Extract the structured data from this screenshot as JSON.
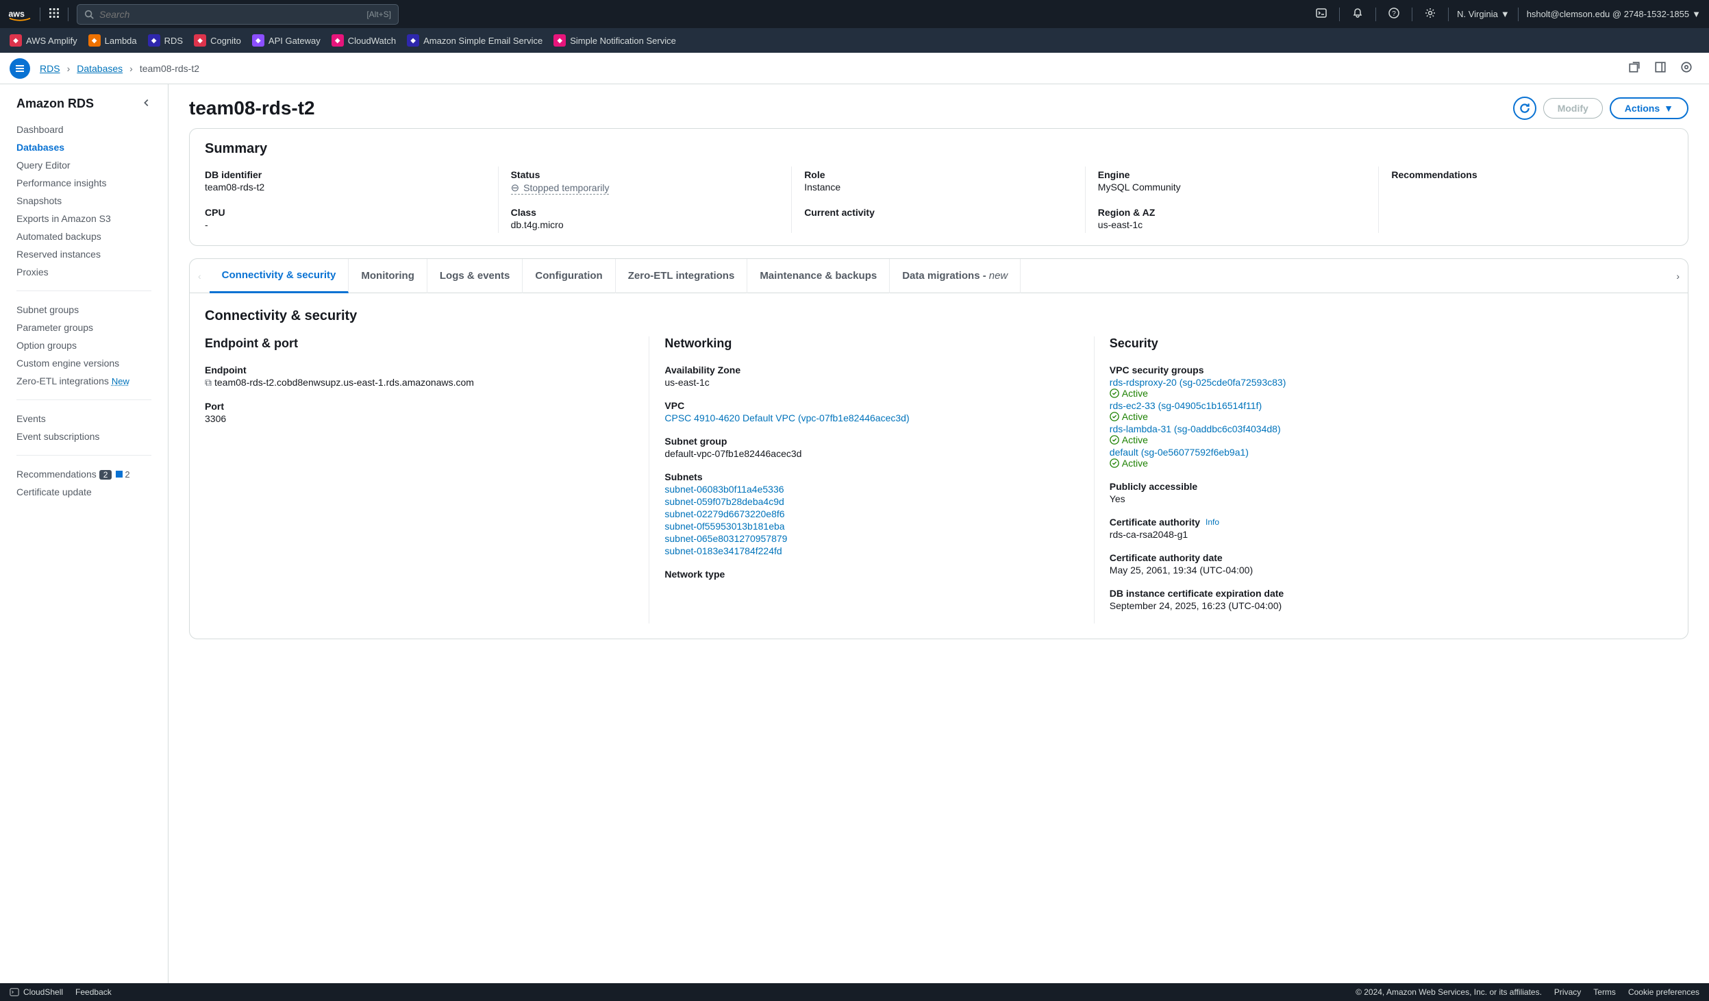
{
  "topnav": {
    "search_placeholder": "Search",
    "search_kbd": "[Alt+S]",
    "region": "N. Virginia",
    "account": "hsholt@clemson.edu @ 2748-1532-1855"
  },
  "favorites": [
    {
      "label": "AWS Amplify",
      "color": "#dd344c"
    },
    {
      "label": "Lambda",
      "color": "#ed7100"
    },
    {
      "label": "RDS",
      "color": "#2e27ad"
    },
    {
      "label": "Cognito",
      "color": "#dd344c"
    },
    {
      "label": "API Gateway",
      "color": "#8c4fff"
    },
    {
      "label": "CloudWatch",
      "color": "#e7157b"
    },
    {
      "label": "Amazon Simple Email Service",
      "color": "#2e27ad"
    },
    {
      "label": "Simple Notification Service",
      "color": "#e7157b"
    }
  ],
  "breadcrumb": {
    "root": "RDS",
    "parent": "Databases",
    "current": "team08-rds-t2"
  },
  "sidebar": {
    "title": "Amazon RDS",
    "groups": [
      [
        "Dashboard",
        "Databases",
        "Query Editor",
        "Performance insights",
        "Snapshots",
        "Exports in Amazon S3",
        "Automated backups",
        "Reserved instances",
        "Proxies"
      ],
      [
        "Subnet groups",
        "Parameter groups",
        "Option groups",
        "Custom engine versions",
        "Zero-ETL integrations"
      ],
      [
        "Events",
        "Event subscriptions"
      ],
      [
        "Recommendations",
        "Certificate update"
      ]
    ],
    "active": "Databases",
    "zero_etl_new": "New",
    "rec_badge1": "2",
    "rec_badge2": "2"
  },
  "page": {
    "title": "team08-rds-t2",
    "modify": "Modify",
    "actions": "Actions"
  },
  "summary": {
    "title": "Summary",
    "cells": [
      {
        "label": "DB identifier",
        "value": "team08-rds-t2"
      },
      {
        "label": "Status",
        "value": "Stopped temporarily",
        "status": true
      },
      {
        "label": "Role",
        "value": "Instance"
      },
      {
        "label": "Engine",
        "value": "MySQL Community"
      },
      {
        "label": "Recommendations",
        "value": ""
      },
      {
        "label": "CPU",
        "value": "-"
      },
      {
        "label": "Class",
        "value": "db.t4g.micro"
      },
      {
        "label": "Current activity",
        "value": ""
      },
      {
        "label": "Region & AZ",
        "value": "us-east-1c"
      },
      {
        "label": "",
        "value": ""
      }
    ]
  },
  "tabs": [
    "Connectivity & security",
    "Monitoring",
    "Logs & events",
    "Configuration",
    "Zero-ETL integrations",
    "Maintenance & backups",
    "Data migrations - "
  ],
  "tabs_new": "new",
  "conn": {
    "section_title": "Connectivity & security",
    "endpoint_port": "Endpoint & port",
    "endpoint_label": "Endpoint",
    "endpoint_value": "team08-rds-t2.cobd8enwsupz.us-east-1.rds.amazonaws.com",
    "port_label": "Port",
    "port_value": "3306",
    "networking": "Networking",
    "az_label": "Availability Zone",
    "az_value": "us-east-1c",
    "vpc_label": "VPC",
    "vpc_link": "CPSC 4910-4620 Default VPC (vpc-07fb1e82446acec3d)",
    "subnet_group_label": "Subnet group",
    "subnet_group_value": "default-vpc-07fb1e82446acec3d",
    "subnets_label": "Subnets",
    "subnets": [
      "subnet-06083b0f11a4e5336",
      "subnet-059f07b28deba4c9d",
      "subnet-02279d6673220e8f6",
      "subnet-0f55953013b181eba",
      "subnet-065e8031270957879",
      "subnet-0183e341784f224fd"
    ],
    "network_type_label": "Network type",
    "security": "Security",
    "vpc_sg_label": "VPC security groups",
    "sgs": [
      {
        "name": "rds-rdsproxy-20 (sg-025cde0fa72593c83)"
      },
      {
        "name": "rds-ec2-33 (sg-04905c1b16514f11f)"
      },
      {
        "name": "rds-lambda-31 (sg-0addbc6c03f4034d8)"
      },
      {
        "name": "default (sg-0e56077592f6eb9a1)"
      }
    ],
    "active_text": "Active",
    "public_label": "Publicly accessible",
    "public_value": "Yes",
    "ca_label": "Certificate authority",
    "info": "Info",
    "ca_value": "rds-ca-rsa2048-g1",
    "ca_date_label": "Certificate authority date",
    "ca_date_value": "May 25, 2061, 19:34 (UTC-04:00)",
    "db_cert_label": "DB instance certificate expiration date",
    "db_cert_value": "September 24, 2025, 16:23 (UTC-04:00)"
  },
  "footer": {
    "cloudshell": "CloudShell",
    "feedback": "Feedback",
    "copyright": "© 2024, Amazon Web Services, Inc. or its affiliates.",
    "privacy": "Privacy",
    "terms": "Terms",
    "cookies": "Cookie preferences"
  }
}
